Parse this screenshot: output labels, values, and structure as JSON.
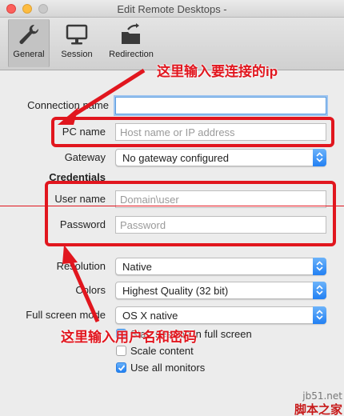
{
  "window": {
    "title": "Edit Remote Desktops -"
  },
  "toolbar": {
    "items": [
      {
        "label": "General",
        "icon": "wrench-icon",
        "active": true
      },
      {
        "label": "Session",
        "icon": "monitor-icon",
        "active": false
      },
      {
        "label": "Redirection",
        "icon": "folder-redirect-icon",
        "active": false
      }
    ]
  },
  "form": {
    "connection_name": {
      "label": "Connection name",
      "value": ""
    },
    "pc_name": {
      "label": "PC name",
      "placeholder": "Host name or IP address"
    },
    "gateway": {
      "label": "Gateway",
      "value": "No gateway configured"
    },
    "credentials_heading": "Credentials",
    "user_name": {
      "label": "User name",
      "placeholder": "Domain\\user"
    },
    "password": {
      "label": "Password",
      "placeholder": "Password"
    },
    "resolution": {
      "label": "Resolution",
      "value": "Native"
    },
    "colors": {
      "label": "Colors",
      "value": "Highest Quality (32 bit)"
    },
    "full_screen_mode": {
      "label": "Full screen mode",
      "value": "OS X native"
    },
    "checkboxes": [
      {
        "label": "Start session in full screen",
        "checked": true
      },
      {
        "label": "Scale content",
        "checked": false
      },
      {
        "label": "Use all monitors",
        "checked": true
      }
    ]
  },
  "annotations": {
    "ip_note": "这里输入要连接的ip",
    "credentials_note": "这里输入用户名和密码",
    "color": "#e1161e"
  },
  "watermark": {
    "site": "jb51.net",
    "name": "脚本之家"
  }
}
